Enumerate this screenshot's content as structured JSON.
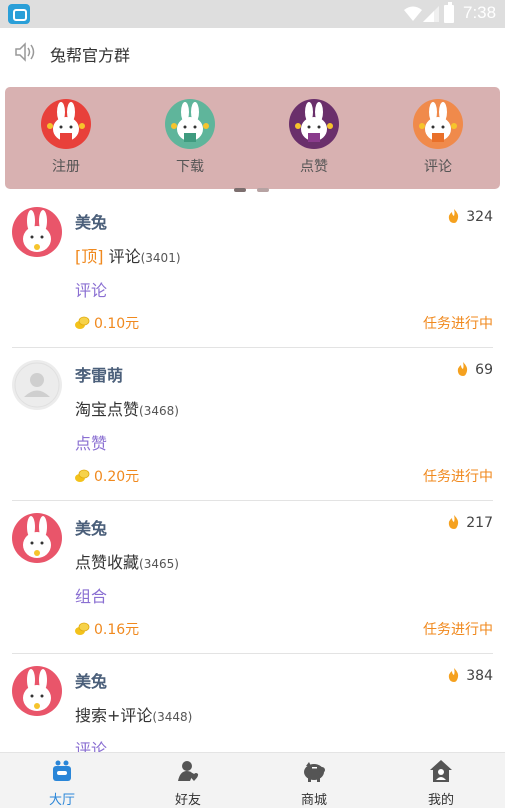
{
  "status_bar": {
    "time": "7:38"
  },
  "announcement": {
    "icon": "speaker-icon",
    "text": "兔帮官方群"
  },
  "banner": {
    "items": [
      {
        "label": "注册",
        "color": "#e8403a",
        "badge_color": "#e8403a"
      },
      {
        "label": "下载",
        "color": "#5fb59b",
        "badge_color": "#5fb59b"
      },
      {
        "label": "点赞",
        "color": "#6a2f6b",
        "badge_color": "#8a3b8c"
      },
      {
        "label": "评论",
        "color": "#f08a4b",
        "badge_color": "#f08a4b"
      }
    ],
    "active_page": 1,
    "page_count": 2
  },
  "tasks": [
    {
      "user": "美兔",
      "avatar": "bunny",
      "heat": "324",
      "top_tag": "[顶]",
      "title": "评论",
      "id": "(3401)",
      "category": "评论",
      "reward": "0.10元",
      "status": "任务进行中"
    },
    {
      "user": "李雷萌",
      "avatar": "default",
      "heat": "69",
      "top_tag": "",
      "title": "淘宝点赞",
      "id": "(3468)",
      "category": "点赞",
      "reward": "0.20元",
      "status": "任务进行中"
    },
    {
      "user": "美兔",
      "avatar": "bunny",
      "heat": "217",
      "top_tag": "",
      "title": "点赞收藏",
      "id": "(3465)",
      "category": "组合",
      "reward": "0.16元",
      "status": "任务进行中"
    },
    {
      "user": "美兔",
      "avatar": "bunny",
      "heat": "384",
      "top_tag": "",
      "title": "搜索+评论",
      "id": "(3448)",
      "category": "评论",
      "reward": "",
      "status": ""
    }
  ],
  "tabs": [
    {
      "label": "大厅",
      "icon": "hall-icon",
      "active": true
    },
    {
      "label": "好友",
      "icon": "friends-icon",
      "active": false
    },
    {
      "label": "商城",
      "icon": "piggy-bank-icon",
      "active": false
    },
    {
      "label": "我的",
      "icon": "home-profile-icon",
      "active": false
    }
  ],
  "colors": {
    "accent": "#2a86d8",
    "orange": "#f0891e",
    "purple": "#8a6fd2",
    "banner_bg": "#d8b1b1"
  }
}
